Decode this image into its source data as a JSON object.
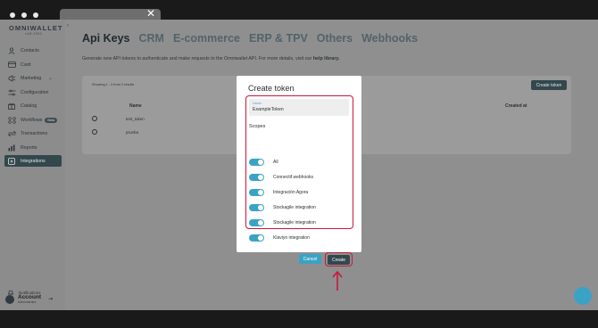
{
  "browser": {
    "close_glyph": "✕"
  },
  "sidebar": {
    "logo_name": "OMNIWALLET",
    "logo_sub": "LAB 2000",
    "collapse_glyph": "‹",
    "items": [
      {
        "label": "Contacts",
        "icon": "user-icon"
      },
      {
        "label": "Card",
        "icon": "card-icon"
      },
      {
        "label": "Marketing",
        "icon": "megaphone-icon"
      },
      {
        "label": "Configuration",
        "icon": "sliders-icon"
      },
      {
        "label": "Catalog",
        "icon": "gift-icon"
      },
      {
        "label": "Workflows",
        "icon": "workflow-icon",
        "badge": "Beta"
      },
      {
        "label": "Transactions",
        "icon": "transactions-icon"
      },
      {
        "label": "Reports",
        "icon": "chart-icon"
      },
      {
        "label": "Integrations",
        "icon": "integrations-icon",
        "active": true
      }
    ],
    "notifications_label": "Notifications",
    "account_name": "Account",
    "account_role": "Administrator"
  },
  "main": {
    "tabs": [
      "Api Keys",
      "CRM",
      "E-commerce",
      "ERP & TPV",
      "Others",
      "Webhooks"
    ],
    "description": "Generate new API tokens to authenticate and make requests to the Omniwallet API. For more details, visit our",
    "description_link": "help library.",
    "showing": "Showing 1 - 2 from 2 results",
    "create_token_button": "Create token",
    "col_name": "Name",
    "col_created": "Created at",
    "rows": [
      "test_token",
      "prueba"
    ]
  },
  "modal": {
    "title": "Create token",
    "name_label": "Name",
    "name_value": "ExampleToken",
    "scopes_title": "Scopes",
    "scopes": [
      {
        "label": "All",
        "enabled": true
      },
      {
        "label": "Connectif webhooks",
        "enabled": true
      },
      {
        "label": "Integración Agora",
        "enabled": true
      },
      {
        "label": "Stockagile integration",
        "enabled": true
      },
      {
        "label": "Stockagile integration",
        "enabled": true
      },
      {
        "label": "Klaviyo integration",
        "enabled": true
      }
    ],
    "cancel_button": "Cancel",
    "create_button": "Create"
  },
  "colors": {
    "accent": "#3aa3c5",
    "primary_dark": "#33474d",
    "highlight": "#c8183a"
  }
}
